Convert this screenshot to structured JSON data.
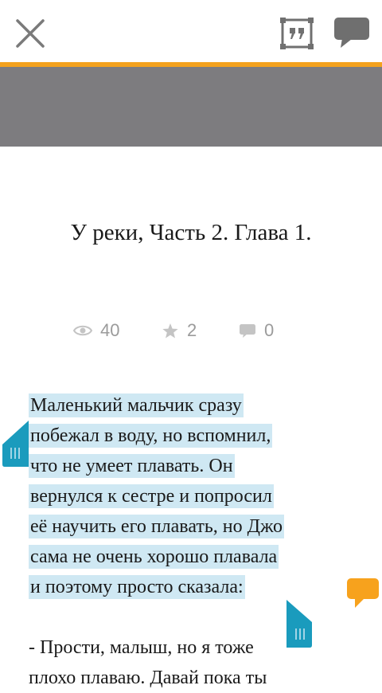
{
  "header": {
    "close_icon": "close-icon",
    "quote_icon": "quote-icon",
    "comments_icon": "chat-bubble-icon",
    "accent_color": "#f4a21d",
    "band_color": "#7d7c7f"
  },
  "chapter": {
    "title": "У реки, Часть 2. Глава 1."
  },
  "stats": {
    "views": "40",
    "likes": "2",
    "comments": "0"
  },
  "text": {
    "highlighted_lines": [
      "Маленький мальчик сразу",
      "побежал в воду, но вспомнил,",
      "что не умеет плавать. Он",
      "вернулся к сестре и попросил",
      "её научить его плавать, но Джо",
      "сама не очень хорошо плавала",
      "и поэтому просто сказала:"
    ],
    "next_lines": [
      "- Прости, малыш, но я тоже",
      "плохо плаваю. Давай пока ты"
    ],
    "highlight_color": "#cfe8f3"
  },
  "selection": {
    "handle_color": "#1a9bbd",
    "note_color": "#f7a21d"
  }
}
